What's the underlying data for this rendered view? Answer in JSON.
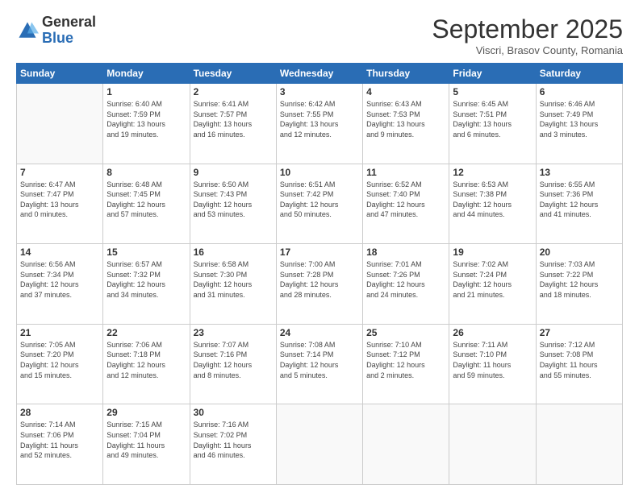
{
  "header": {
    "logo_general": "General",
    "logo_blue": "Blue",
    "month_title": "September 2025",
    "location": "Viscri, Brasov County, Romania"
  },
  "days_of_week": [
    "Sunday",
    "Monday",
    "Tuesday",
    "Wednesday",
    "Thursday",
    "Friday",
    "Saturday"
  ],
  "weeks": [
    [
      {
        "day": "",
        "info": ""
      },
      {
        "day": "1",
        "info": "Sunrise: 6:40 AM\nSunset: 7:59 PM\nDaylight: 13 hours\nand 19 minutes."
      },
      {
        "day": "2",
        "info": "Sunrise: 6:41 AM\nSunset: 7:57 PM\nDaylight: 13 hours\nand 16 minutes."
      },
      {
        "day": "3",
        "info": "Sunrise: 6:42 AM\nSunset: 7:55 PM\nDaylight: 13 hours\nand 12 minutes."
      },
      {
        "day": "4",
        "info": "Sunrise: 6:43 AM\nSunset: 7:53 PM\nDaylight: 13 hours\nand 9 minutes."
      },
      {
        "day": "5",
        "info": "Sunrise: 6:45 AM\nSunset: 7:51 PM\nDaylight: 13 hours\nand 6 minutes."
      },
      {
        "day": "6",
        "info": "Sunrise: 6:46 AM\nSunset: 7:49 PM\nDaylight: 13 hours\nand 3 minutes."
      }
    ],
    [
      {
        "day": "7",
        "info": "Sunrise: 6:47 AM\nSunset: 7:47 PM\nDaylight: 13 hours\nand 0 minutes."
      },
      {
        "day": "8",
        "info": "Sunrise: 6:48 AM\nSunset: 7:45 PM\nDaylight: 12 hours\nand 57 minutes."
      },
      {
        "day": "9",
        "info": "Sunrise: 6:50 AM\nSunset: 7:43 PM\nDaylight: 12 hours\nand 53 minutes."
      },
      {
        "day": "10",
        "info": "Sunrise: 6:51 AM\nSunset: 7:42 PM\nDaylight: 12 hours\nand 50 minutes."
      },
      {
        "day": "11",
        "info": "Sunrise: 6:52 AM\nSunset: 7:40 PM\nDaylight: 12 hours\nand 47 minutes."
      },
      {
        "day": "12",
        "info": "Sunrise: 6:53 AM\nSunset: 7:38 PM\nDaylight: 12 hours\nand 44 minutes."
      },
      {
        "day": "13",
        "info": "Sunrise: 6:55 AM\nSunset: 7:36 PM\nDaylight: 12 hours\nand 41 minutes."
      }
    ],
    [
      {
        "day": "14",
        "info": "Sunrise: 6:56 AM\nSunset: 7:34 PM\nDaylight: 12 hours\nand 37 minutes."
      },
      {
        "day": "15",
        "info": "Sunrise: 6:57 AM\nSunset: 7:32 PM\nDaylight: 12 hours\nand 34 minutes."
      },
      {
        "day": "16",
        "info": "Sunrise: 6:58 AM\nSunset: 7:30 PM\nDaylight: 12 hours\nand 31 minutes."
      },
      {
        "day": "17",
        "info": "Sunrise: 7:00 AM\nSunset: 7:28 PM\nDaylight: 12 hours\nand 28 minutes."
      },
      {
        "day": "18",
        "info": "Sunrise: 7:01 AM\nSunset: 7:26 PM\nDaylight: 12 hours\nand 24 minutes."
      },
      {
        "day": "19",
        "info": "Sunrise: 7:02 AM\nSunset: 7:24 PM\nDaylight: 12 hours\nand 21 minutes."
      },
      {
        "day": "20",
        "info": "Sunrise: 7:03 AM\nSunset: 7:22 PM\nDaylight: 12 hours\nand 18 minutes."
      }
    ],
    [
      {
        "day": "21",
        "info": "Sunrise: 7:05 AM\nSunset: 7:20 PM\nDaylight: 12 hours\nand 15 minutes."
      },
      {
        "day": "22",
        "info": "Sunrise: 7:06 AM\nSunset: 7:18 PM\nDaylight: 12 hours\nand 12 minutes."
      },
      {
        "day": "23",
        "info": "Sunrise: 7:07 AM\nSunset: 7:16 PM\nDaylight: 12 hours\nand 8 minutes."
      },
      {
        "day": "24",
        "info": "Sunrise: 7:08 AM\nSunset: 7:14 PM\nDaylight: 12 hours\nand 5 minutes."
      },
      {
        "day": "25",
        "info": "Sunrise: 7:10 AM\nSunset: 7:12 PM\nDaylight: 12 hours\nand 2 minutes."
      },
      {
        "day": "26",
        "info": "Sunrise: 7:11 AM\nSunset: 7:10 PM\nDaylight: 11 hours\nand 59 minutes."
      },
      {
        "day": "27",
        "info": "Sunrise: 7:12 AM\nSunset: 7:08 PM\nDaylight: 11 hours\nand 55 minutes."
      }
    ],
    [
      {
        "day": "28",
        "info": "Sunrise: 7:14 AM\nSunset: 7:06 PM\nDaylight: 11 hours\nand 52 minutes."
      },
      {
        "day": "29",
        "info": "Sunrise: 7:15 AM\nSunset: 7:04 PM\nDaylight: 11 hours\nand 49 minutes."
      },
      {
        "day": "30",
        "info": "Sunrise: 7:16 AM\nSunset: 7:02 PM\nDaylight: 11 hours\nand 46 minutes."
      },
      {
        "day": "",
        "info": ""
      },
      {
        "day": "",
        "info": ""
      },
      {
        "day": "",
        "info": ""
      },
      {
        "day": "",
        "info": ""
      }
    ]
  ]
}
